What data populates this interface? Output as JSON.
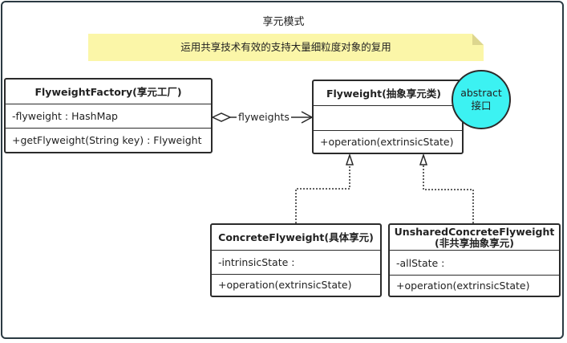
{
  "diagram": {
    "title": "享元模式",
    "note": "运用共享技术有效的支持大量细粒度对象的复用",
    "classes": {
      "factory": {
        "name": "FlyweightFactory(享元工厂)",
        "attribute": "-flyweight : HashMap",
        "operation": "+getFlyweight(String key) : Flyweight"
      },
      "flyweight": {
        "name": "Flyweight(抽象享元类)",
        "attribute": "",
        "operation": "+operation(extrinsicState)"
      },
      "concrete": {
        "name": "ConcreteFlyweight(具体享元)",
        "attribute": "-intrinsicState :",
        "operation": "+operation(extrinsicState)"
      },
      "unshared": {
        "name_line1": "UnsharedConcreteFlyweight",
        "name_line2": "(非共享抽象享元)",
        "attribute": "-allState :",
        "operation": "+operation(extrinsicState)"
      }
    },
    "association_label": "flyweights",
    "badge": {
      "line1": "abstract",
      "line2": "接口",
      "color": "#3cf2f2"
    },
    "colors": {
      "note_bg": "#fbf6a8",
      "border": "#2b2b2b",
      "frame": "#2b3a42"
    }
  }
}
